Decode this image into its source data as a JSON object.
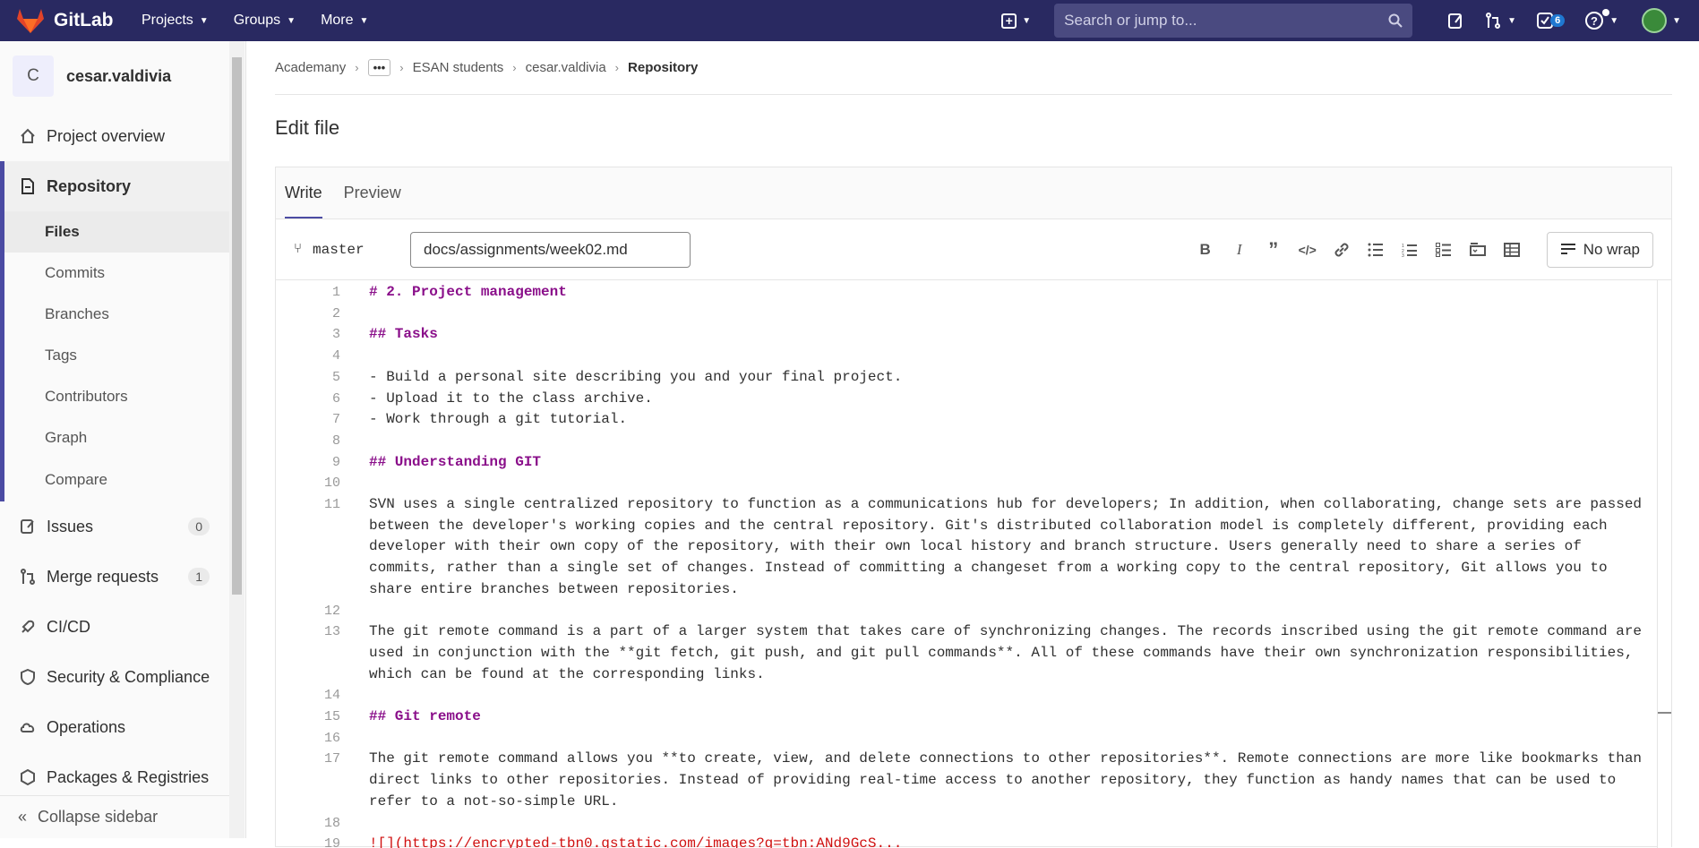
{
  "colors": {
    "navbar": "#292961",
    "accent": "#4b4ba3",
    "heading_text": "#8a0f8a",
    "link_text": "#d01010"
  },
  "navbar": {
    "brand": "GitLab",
    "menu": [
      {
        "label": "Projects",
        "icon": "chevron-down-icon"
      },
      {
        "label": "Groups",
        "icon": "chevron-down-icon"
      },
      {
        "label": "More",
        "icon": "chevron-down-icon"
      }
    ],
    "search_placeholder": "Search or jump to...",
    "todo_count": "6"
  },
  "sidebar": {
    "project_initial": "C",
    "project_name": "cesar.valdivia",
    "overview": "Project overview",
    "repository": "Repository",
    "repo_items": [
      "Files",
      "Commits",
      "Branches",
      "Tags",
      "Contributors",
      "Graph",
      "Compare"
    ],
    "issues": "Issues",
    "issues_count": "0",
    "merge_requests": "Merge requests",
    "merge_requests_count": "1",
    "cicd": "CI/CD",
    "security": "Security & Compliance",
    "operations": "Operations",
    "packages": "Packages & Registries",
    "collapse": "Collapse sidebar"
  },
  "breadcrumb": {
    "items": [
      "Academany",
      "ESAN students",
      "cesar.valdivia"
    ],
    "current": "Repository",
    "ellipsis": "•••"
  },
  "page": {
    "title": "Edit file",
    "tabs": [
      "Write",
      "Preview"
    ],
    "branch": "master",
    "file_path": "docs/assignments/week02.md",
    "nowrap_label": "No wrap"
  },
  "markdown_tools": [
    "bold-icon",
    "italic-icon",
    "quote-icon",
    "code-icon",
    "link-icon",
    "bullet-list-icon",
    "numbered-list-icon",
    "task-list-icon",
    "collapsible-icon",
    "table-icon"
  ],
  "code_lines": [
    {
      "n": "1",
      "text": "# 2. Project management",
      "kind": "heading"
    },
    {
      "n": "2",
      "text": "",
      "kind": "plain"
    },
    {
      "n": "3",
      "text": "## Tasks",
      "kind": "heading"
    },
    {
      "n": "4",
      "text": "",
      "kind": "plain"
    },
    {
      "n": "5",
      "text": "- Build a personal site describing you and your final project.",
      "kind": "plain"
    },
    {
      "n": "6",
      "text": "- Upload it to the class archive.",
      "kind": "plain"
    },
    {
      "n": "7",
      "text": "- Work through a git tutorial.",
      "kind": "plain"
    },
    {
      "n": "8",
      "text": "",
      "kind": "plain"
    },
    {
      "n": "9",
      "text": "## Understanding GIT",
      "kind": "heading"
    },
    {
      "n": "10",
      "text": "",
      "kind": "plain"
    },
    {
      "n": "11",
      "text": "SVN uses a single centralized repository to function as a communications hub for developers; In addition, when collaborating, change sets are passed between the developer's working copies and the central repository. Git's distributed collaboration model is completely different, providing each developer with their own copy of the repository, with their own local history and branch structure. Users generally need to share a series of commits, rather than a single set of changes. Instead of committing a changeset from a working copy to the central repository, Git allows you to share entire branches between repositories.",
      "kind": "plain"
    },
    {
      "n": "12",
      "text": "",
      "kind": "plain"
    },
    {
      "n": "13",
      "text": "The git remote command is a part of a larger system that takes care of synchronizing changes. The records inscribed using the git remote command are used in conjunction with the **git fetch, git push, and git pull commands**. All of these commands have their own synchronization responsibilities, which can be found at the corresponding links.",
      "kind": "plain"
    },
    {
      "n": "14",
      "text": "",
      "kind": "plain"
    },
    {
      "n": "15",
      "text": "## Git remote",
      "kind": "heading"
    },
    {
      "n": "16",
      "text": "",
      "kind": "plain"
    },
    {
      "n": "17",
      "text": "The git remote command allows you **to create, view, and delete connections to other repositories**. Remote connections are more like bookmarks than direct links to other repositories. Instead of providing real-time access to another repository, they function as handy names that can be used to refer to a not-so-simple URL.",
      "kind": "plain"
    },
    {
      "n": "18",
      "text": "",
      "kind": "plain"
    },
    {
      "n": "19",
      "text": "![](https://encrypted-tbn0.gstatic.com/images?q=tbn:ANd9GcS...",
      "kind": "link"
    }
  ]
}
